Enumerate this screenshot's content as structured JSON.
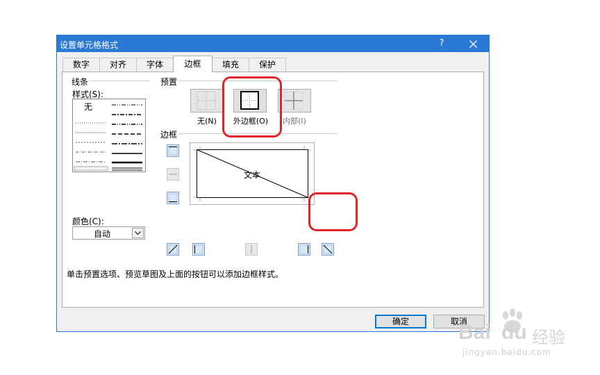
{
  "dialog": {
    "title": "设置单元格格式",
    "help_label": "?",
    "tabs": [
      {
        "label": "数字",
        "active": false
      },
      {
        "label": "对齐",
        "active": false
      },
      {
        "label": "字体",
        "active": false
      },
      {
        "label": "边框",
        "active": true
      },
      {
        "label": "填充",
        "active": false
      },
      {
        "label": "保护",
        "active": false
      }
    ],
    "line": {
      "group_label": "线条",
      "style_label": "样式(S):",
      "none_label": "无",
      "color_label": "颜色(C):",
      "color_value": "自动"
    },
    "presets": {
      "group_label": "预置",
      "items": [
        {
          "label": "无(N)",
          "icon": "border-none-icon"
        },
        {
          "label": "外边框(O)",
          "icon": "border-outline-icon"
        },
        {
          "label": "内部(I)",
          "icon": "border-inside-icon"
        }
      ]
    },
    "border": {
      "group_label": "边框",
      "preview_text": "文本"
    },
    "hint": "单击预置选项、预览草图及上面的按钮可以添加边框样式。",
    "ok_label": "确定",
    "cancel_label": "取消"
  },
  "watermark": {
    "brand": "Bai",
    "brand2": "du",
    "product": "经验",
    "url": "jingyan.baidu.com"
  },
  "colors": {
    "titlebar": "#2b79d7",
    "highlight": "#e0242a"
  }
}
